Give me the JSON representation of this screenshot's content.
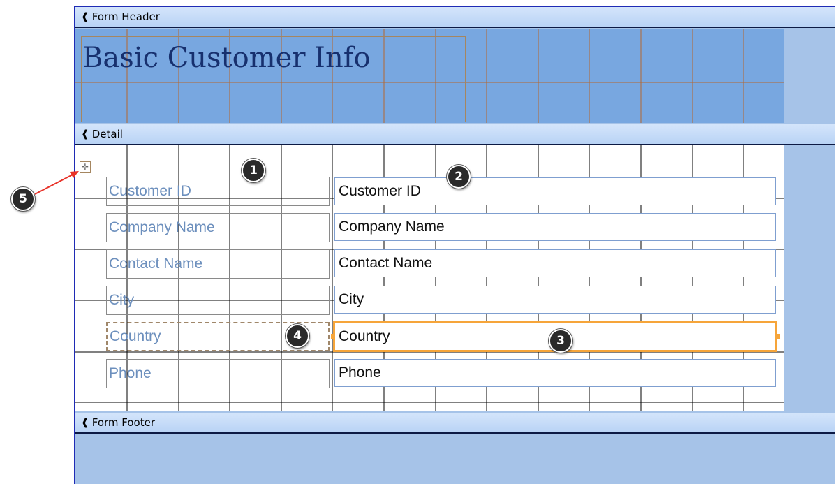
{
  "sections": {
    "header_label": "Form Header",
    "detail_label": "Detail",
    "footer_label": "Form Footer"
  },
  "form": {
    "title": "Basic Customer Info"
  },
  "fields": [
    {
      "label": "Customer ID",
      "textbox": "Customer ID"
    },
    {
      "label": "Company Name",
      "textbox": "Company Name"
    },
    {
      "label": "Contact Name",
      "textbox": "Contact Name"
    },
    {
      "label": "City",
      "textbox": "City"
    },
    {
      "label": "Country",
      "textbox": "Country"
    },
    {
      "label": "Phone",
      "textbox": "Phone"
    }
  ],
  "callouts": {
    "c1": "1",
    "c2": "2",
    "c3": "3",
    "c4": "4",
    "c5": "5"
  },
  "icons": {
    "section_glyph": "section-arrow-icon",
    "move": "move-handle-icon"
  },
  "colors": {
    "header_fill": "#78a7e0",
    "selection": "#f6a53a",
    "arrow": "#e8332a"
  }
}
